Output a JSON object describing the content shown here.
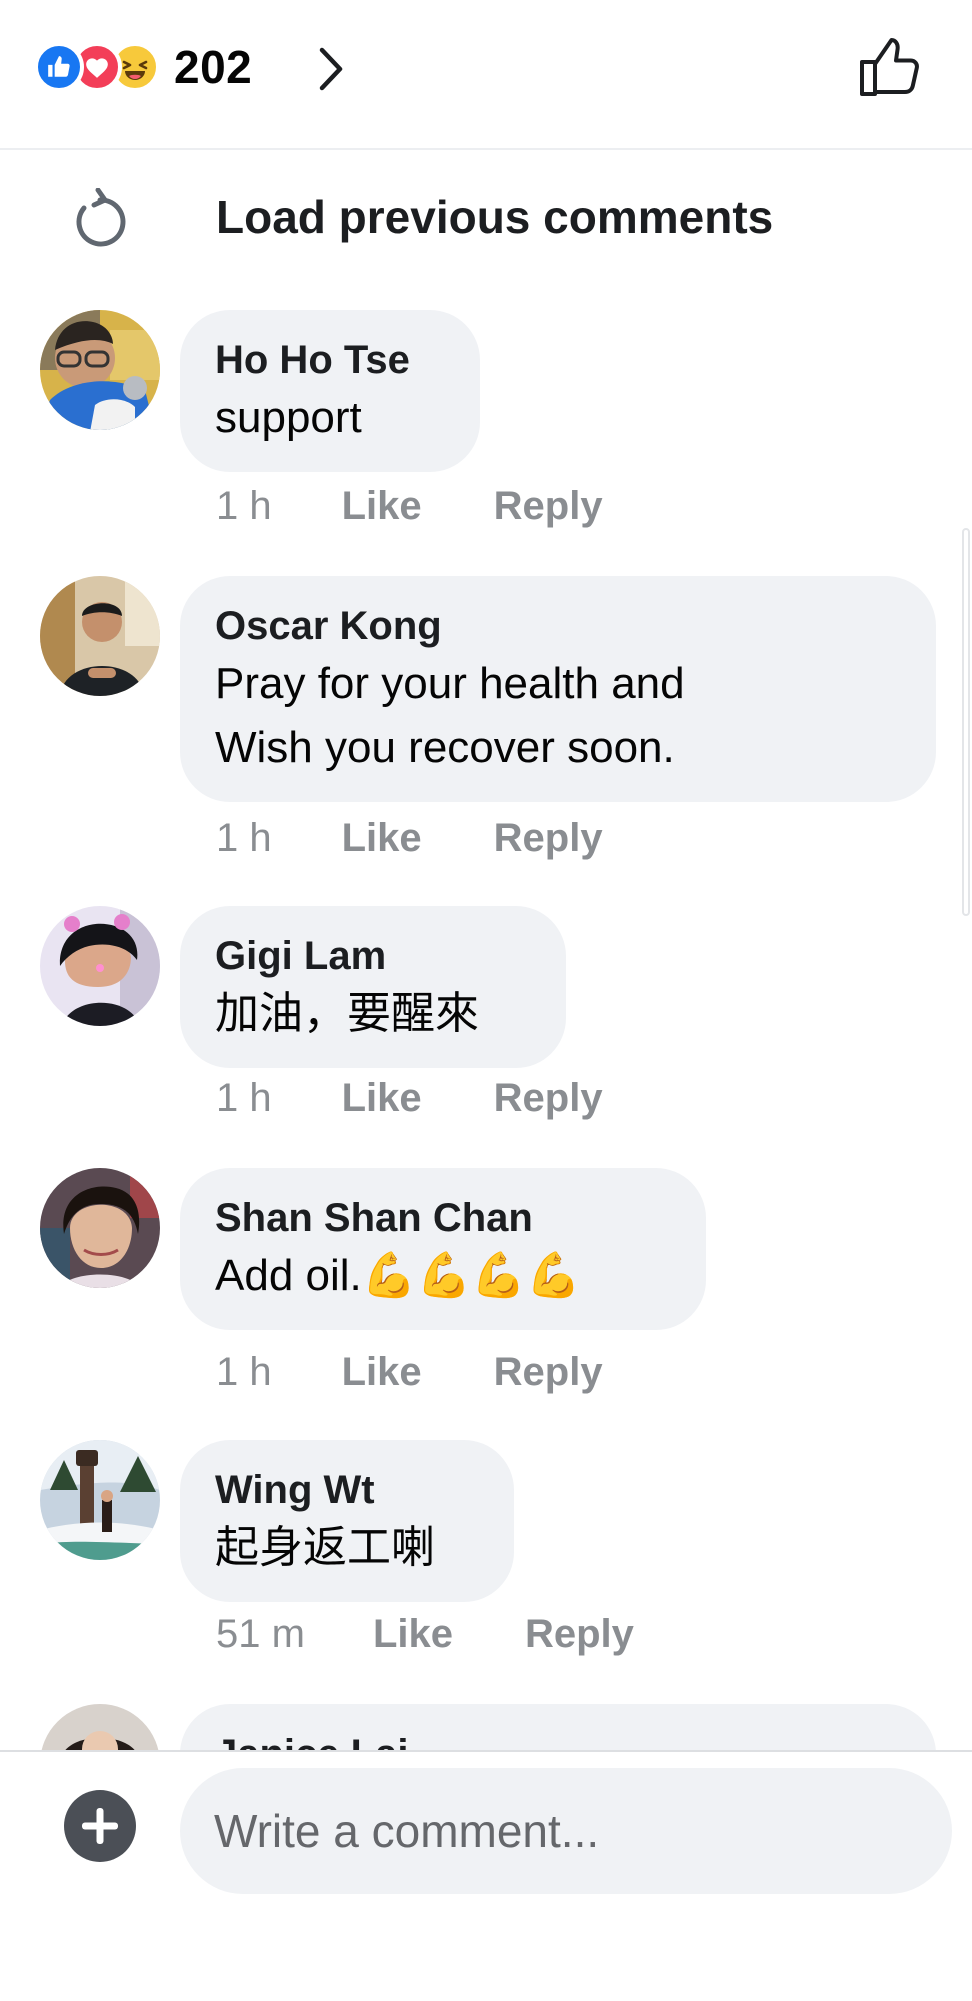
{
  "reactions": {
    "count": "202",
    "types": [
      "like-icon",
      "love-icon",
      "haha-icon"
    ],
    "colors": {
      "like": "#1877f2",
      "love": "#f33e58",
      "haha": "#f7c93b"
    }
  },
  "load_previous": {
    "label": "Load previous comments"
  },
  "comments": [
    {
      "name": "Ho Ho Tse",
      "text": [
        "support"
      ],
      "time": "1 h",
      "like": "Like",
      "reply": "Reply"
    },
    {
      "name": "Oscar Kong",
      "text": [
        "Pray for your health and",
        "Wish you recover soon."
      ],
      "time": "1 h",
      "like": "Like",
      "reply": "Reply"
    },
    {
      "name": "Gigi Lam",
      "text": [
        "加油，要醒來"
      ],
      "time": "1 h",
      "like": "Like",
      "reply": "Reply"
    },
    {
      "name": "Shan Shan Chan",
      "text": [
        "Add oil.💪💪💪💪"
      ],
      "time": "1 h",
      "like": "Like",
      "reply": "Reply"
    },
    {
      "name": "Wing Wt",
      "text": [
        "起身返工喇"
      ],
      "time": "51 m",
      "like": "Like",
      "reply": "Reply"
    },
    {
      "name": "Janice Lai",
      "text": [],
      "time": "",
      "like": "",
      "reply": ""
    }
  ],
  "composer": {
    "placeholder": "Write a comment..."
  },
  "theme": {
    "bubble": "#f0f2f5",
    "meta_text": "#8a8d91",
    "accent": "#1877f2"
  }
}
